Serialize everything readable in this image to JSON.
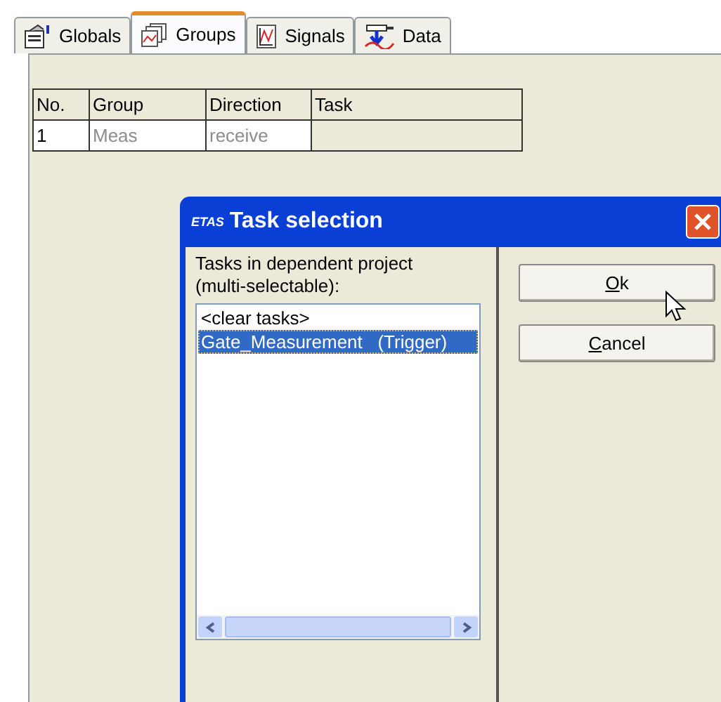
{
  "tabs": [
    {
      "label": "Globals",
      "kind": "globals",
      "selected": false
    },
    {
      "label": "Groups",
      "kind": "groups",
      "selected": true
    },
    {
      "label": "Signals",
      "kind": "signals",
      "selected": false
    },
    {
      "label": "Data",
      "kind": "data",
      "selected": false
    }
  ],
  "table": {
    "columns": [
      "No.",
      "Group",
      "Direction",
      "Task"
    ],
    "rows": [
      [
        "1",
        "Meas",
        "receive",
        ""
      ]
    ]
  },
  "dialog": {
    "logo": "ETAS",
    "title": "Task selection",
    "list_label": "Tasks in dependent project (multi-selectable):",
    "items": [
      {
        "label": "<clear tasks>",
        "selected": false
      },
      {
        "label": "Gate_Measurement   (Trigger)",
        "selected": true
      }
    ],
    "buttons": [
      "Ok",
      "Cancel"
    ]
  }
}
